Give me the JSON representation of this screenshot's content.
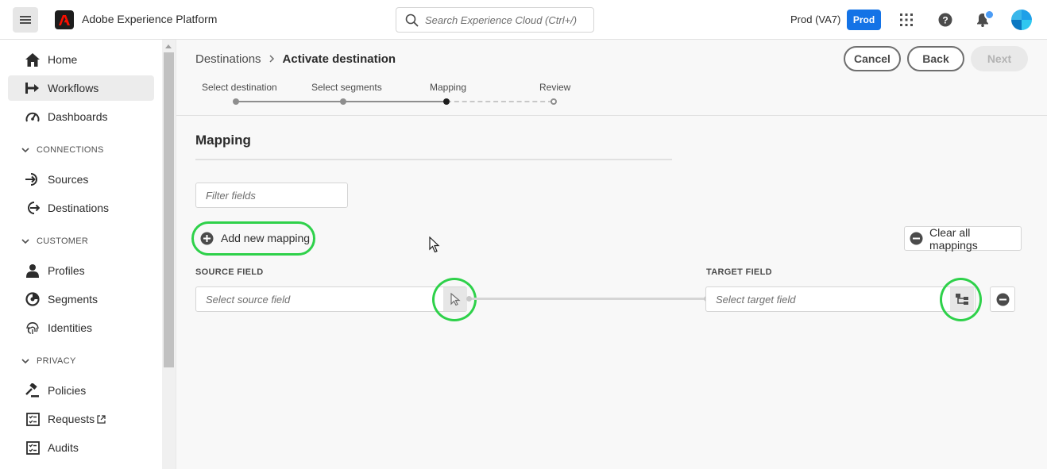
{
  "header": {
    "app_title": "Adobe Experience Platform",
    "search_placeholder": "Search Experience Cloud (Ctrl+/)",
    "org_name": "Prod (VA7)",
    "env_badge": "Prod"
  },
  "sidebar": {
    "items_top": [
      {
        "label": "Home",
        "icon": "home-icon"
      },
      {
        "label": "Workflows",
        "icon": "workflows-icon",
        "active": true
      },
      {
        "label": "Dashboards",
        "icon": "dashboard-icon"
      }
    ],
    "sections": [
      {
        "title": "CONNECTIONS",
        "items": [
          {
            "label": "Sources",
            "icon": "sources-icon"
          },
          {
            "label": "Destinations",
            "icon": "destinations-icon"
          }
        ]
      },
      {
        "title": "CUSTOMER",
        "items": [
          {
            "label": "Profiles",
            "icon": "profiles-icon"
          },
          {
            "label": "Segments",
            "icon": "segments-icon"
          },
          {
            "label": "Identities",
            "icon": "fingerprint-icon"
          }
        ]
      },
      {
        "title": "PRIVACY",
        "items": [
          {
            "label": "Policies",
            "icon": "gavel-icon"
          },
          {
            "label": "Requests",
            "icon": "requests-icon",
            "external": true
          },
          {
            "label": "Audits",
            "icon": "audits-icon"
          }
        ]
      }
    ]
  },
  "breadcrumb": {
    "parent": "Destinations",
    "current": "Activate destination"
  },
  "actions": {
    "cancel": "Cancel",
    "back": "Back",
    "next": "Next"
  },
  "stepper": {
    "steps": [
      "Select destination",
      "Select segments",
      "Mapping",
      "Review"
    ],
    "current_index": 2
  },
  "mapping": {
    "title": "Mapping",
    "filter_placeholder": "Filter fields",
    "add_label": "Add new mapping",
    "clear_label": "Clear all mappings",
    "source_header": "SOURCE FIELD",
    "target_header": "TARGET FIELD",
    "source_placeholder": "Select source field",
    "target_placeholder": "Select target field"
  },
  "colors": {
    "accent": "#1473e6",
    "highlight": "#2ed14a"
  }
}
